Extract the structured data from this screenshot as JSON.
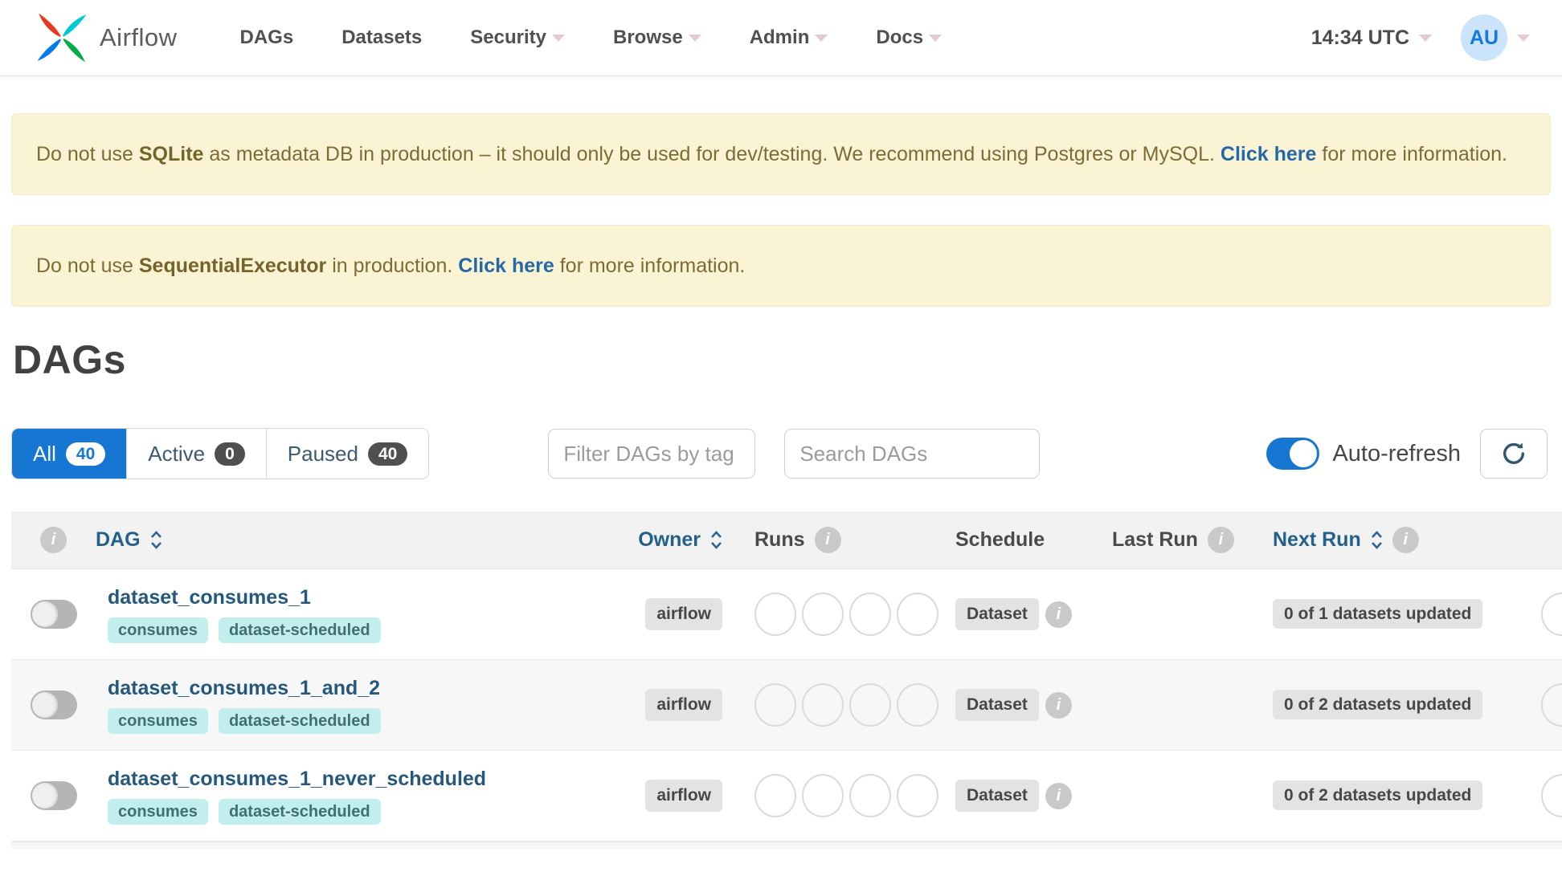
{
  "navbar": {
    "brand": "Airflow",
    "items": [
      {
        "label": "DAGs",
        "caret": false
      },
      {
        "label": "Datasets",
        "caret": false
      },
      {
        "label": "Security",
        "caret": true
      },
      {
        "label": "Browse",
        "caret": true
      },
      {
        "label": "Admin",
        "caret": true
      },
      {
        "label": "Docs",
        "caret": true
      }
    ],
    "clock": "14:34 UTC",
    "avatar_initials": "AU"
  },
  "alerts": [
    {
      "pre": "Do not use ",
      "bold": "SQLite",
      "mid": " as metadata DB in production – it should only be used for dev/testing. We recommend using Postgres or MySQL. ",
      "link": "Click here",
      "post": " for more information."
    },
    {
      "pre": "Do not use ",
      "bold": "SequentialExecutor",
      "mid": " in production. ",
      "link": "Click here",
      "post": " for more information."
    }
  ],
  "page_title": "DAGs",
  "filters": {
    "tabs": [
      {
        "label": "All",
        "count": "40",
        "active": true
      },
      {
        "label": "Active",
        "count": "0",
        "active": false
      },
      {
        "label": "Paused",
        "count": "40",
        "active": false
      }
    ],
    "tag_filter_placeholder": "Filter DAGs by tag",
    "search_placeholder": "Search DAGs",
    "auto_refresh_label": "Auto-refresh",
    "auto_refresh_on": true
  },
  "table": {
    "headers": {
      "dag": "DAG",
      "owner": "Owner",
      "runs": "Runs",
      "schedule": "Schedule",
      "last_run": "Last Run",
      "next_run": "Next Run"
    },
    "rows": [
      {
        "name": "dataset_consumes_1",
        "tags": [
          "consumes",
          "dataset-scheduled"
        ],
        "owner": "airflow",
        "schedule": "Dataset",
        "next_run": "0 of 1 datasets updated",
        "paused": true
      },
      {
        "name": "dataset_consumes_1_and_2",
        "tags": [
          "consumes",
          "dataset-scheduled"
        ],
        "owner": "airflow",
        "schedule": "Dataset",
        "next_run": "0 of 2 datasets updated",
        "paused": true
      },
      {
        "name": "dataset_consumes_1_never_scheduled",
        "tags": [
          "consumes",
          "dataset-scheduled"
        ],
        "owner": "airflow",
        "schedule": "Dataset",
        "next_run": "0 of 2 datasets updated",
        "paused": true
      }
    ]
  },
  "colors": {
    "accent_blue": "#1577d2",
    "nav_text": "#51504f",
    "alert_bg": "#faf4d5",
    "alert_text": "#7d6b35",
    "link_blue": "#2468a6",
    "dag_link": "#24587c",
    "tag_bg": "#c2efee",
    "tag_text": "#41706f",
    "badge_bg": "#e3e3e3",
    "header_sortable": "#23608c",
    "avatar_bg": "#cbe4fb",
    "avatar_text": "#1677e0",
    "logo_red": "#e43921",
    "logo_teal": "#00c7d4",
    "logo_green": "#00ad46",
    "logo_blue": "#017cee"
  }
}
